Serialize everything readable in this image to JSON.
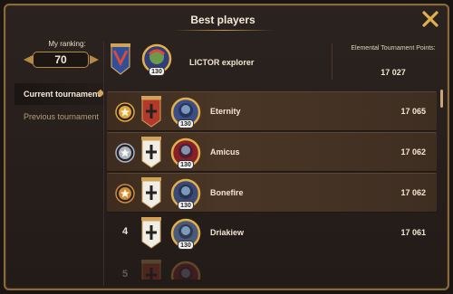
{
  "title": "Best players",
  "ranking": {
    "label": "My ranking:",
    "value": "70"
  },
  "nav": [
    {
      "label": "Current tournament",
      "active": true
    },
    {
      "label": "Previous tournament",
      "active": false
    }
  ],
  "me": {
    "name": "LICTOR explorer",
    "level": "130",
    "points_label": "Elemental Tournament Points:",
    "points": "17 027"
  },
  "players": [
    {
      "medal": "gold",
      "rank": "",
      "name": "Eternity",
      "level": "130",
      "score": "17 065",
      "banner_color": "#b33a2a",
      "avatar_color": "#3b4e8a"
    },
    {
      "medal": "silver",
      "rank": "",
      "name": "Amicus",
      "level": "130",
      "score": "17 062",
      "banner_color": "#f0ede4",
      "avatar_color": "#8a1f2a"
    },
    {
      "medal": "bronze",
      "rank": "",
      "name": "Bonefire",
      "level": "130",
      "score": "17 062",
      "banner_color": "#f0ede4",
      "avatar_color": "#3a4a78"
    },
    {
      "medal": "",
      "rank": "4",
      "name": "Driakiew",
      "level": "130",
      "score": "17 061",
      "banner_color": "#f0ede4",
      "avatar_color": "#4a5a7a"
    },
    {
      "medal": "",
      "rank": "5",
      "name": "",
      "level": "",
      "score": "",
      "banner_color": "#b33a2a",
      "avatar_color": "#8a1f2a"
    }
  ],
  "colors": {
    "gold": "#e0a63a",
    "silver": "#aab4c8",
    "bronze": "#d08a3c",
    "accent": "#c69a4b"
  }
}
